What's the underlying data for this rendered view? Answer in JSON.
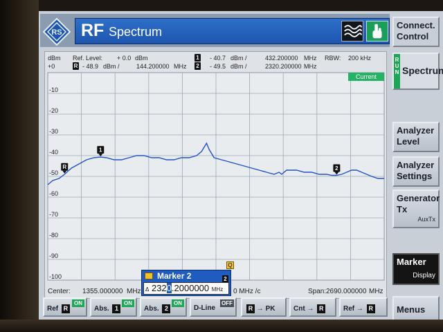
{
  "title": {
    "rf": "RF",
    "mode": "Spectrum"
  },
  "softkeys": {
    "connect": "Connect. Control",
    "run": "RUN",
    "spectrum": "Spectrum",
    "analyzer_level": "Analyzer Level",
    "analyzer_settings": "Analyzer Settings",
    "generator_tx": "Generator Tx",
    "generator_aux": "AuxTx",
    "marker": "Marker",
    "marker_sub": "Display",
    "menus": "Menus"
  },
  "header": {
    "dbm_unit": "dBm",
    "ref_level_label": "Ref. Level:",
    "ref_level_value": "+ 0.0",
    "ref_level_unit": "dBm",
    "m1_id": "1",
    "m1_level": "- 40.7",
    "m1_level_unit": "dBm  /",
    "m1_freq": "432.200000",
    "m1_freq_unit": "MHz",
    "rbw_label": "RBW:",
    "rbw_value": "200 kHz",
    "top_tick": "+0",
    "r_id": "R",
    "r_level": "- 48.9",
    "r_level_unit": "dBm  /",
    "r_freq": "144.200000",
    "r_freq_unit": "MHz",
    "m2_id": "2",
    "m2_level": "- 49.5",
    "m2_level_unit": "dBm  /",
    "m2_freq": "2320.200000",
    "m2_freq_unit": "MHz",
    "current": "Current"
  },
  "y_ticks": [
    "-10",
    "-20",
    "-30",
    "-40",
    "-50",
    "-60",
    "-70",
    "-80",
    "-90",
    "-100"
  ],
  "footer": {
    "center_label": "Center:",
    "center_value": "1355.000000",
    "center_unit": "MHz",
    "span_label": "Span:",
    "span_value": "2690.000000",
    "span_unit": "MHz",
    "partial": "0 MHz  /c"
  },
  "marker_popup": {
    "title": "Marker 2",
    "number": "2",
    "delta": "Δ",
    "value_before": "232",
    "value_cursor": "0",
    "value_after": ".2000000",
    "unit": "MHz"
  },
  "bottom_buttons": {
    "ref": "Ref",
    "ref_badge": "R",
    "ref_state": "ON",
    "abs1": "Abs.",
    "abs1_badge": "1",
    "abs1_state": "ON",
    "abs2": "Abs.",
    "abs2_badge": "2",
    "abs2_state": "ON",
    "dline": "D-Line",
    "dline_state": "OFF",
    "pk_from": "R",
    "pk_arrow": "→",
    "pk_to": "PK",
    "cnt": "Cnt",
    "cnt_arrow": "→",
    "cnt_to": "R",
    "ref_to": "Ref",
    "ref_arrow": "→",
    "ref_to_badge": "R"
  },
  "q_badge": "Q",
  "chart_data": {
    "type": "line",
    "x_unit": "MHz",
    "y_unit": "dBm",
    "xlim": [
      10,
      2700
    ],
    "ylim": [
      -100,
      0
    ],
    "grid": true,
    "series": [
      {
        "x": [
          10,
          50,
          100,
          144,
          200,
          260,
          320,
          380,
          432,
          480,
          540,
          600,
          660,
          720,
          780,
          840,
          900,
          960,
          1020,
          1080,
          1140,
          1200,
          1240,
          1260,
          1280,
          1300,
          1340,
          1400,
          1460,
          1520,
          1580,
          1640,
          1700,
          1760,
          1820,
          1860,
          1880,
          1920,
          1960,
          2000,
          2060,
          2120,
          2180,
          2240,
          2280,
          2320,
          2360,
          2400,
          2440,
          2480,
          2520,
          2560,
          2600,
          2650,
          2700
        ],
        "y": [
          -54,
          -52,
          -51,
          -49,
          -46,
          -44,
          -42,
          -41,
          -40.7,
          -41,
          -42,
          -42,
          -41,
          -40,
          -40,
          -41,
          -41,
          -42,
          -42,
          -41,
          -41,
          -40,
          -38,
          -36,
          -34,
          -37,
          -41,
          -42,
          -43,
          -44,
          -45,
          -46,
          -47,
          -48,
          -49,
          -48,
          -49,
          -47,
          -47,
          -47,
          -48,
          -48,
          -49,
          -49,
          -49.5,
          -49.5,
          -49,
          -48,
          -47,
          -47,
          -48,
          -49,
          -50,
          -51,
          -51
        ]
      }
    ],
    "markers": [
      {
        "id": "R",
        "x": 144.2,
        "y": -48.9
      },
      {
        "id": "1",
        "x": 432.2,
        "y": -40.7
      },
      {
        "id": "2",
        "x": 2320.2,
        "y": -49.5
      }
    ]
  },
  "colors": {
    "trace": "#2050c8",
    "grid": "#9aa8b8",
    "title_blue": "#1d55ae",
    "on_green": "#1fa556"
  }
}
